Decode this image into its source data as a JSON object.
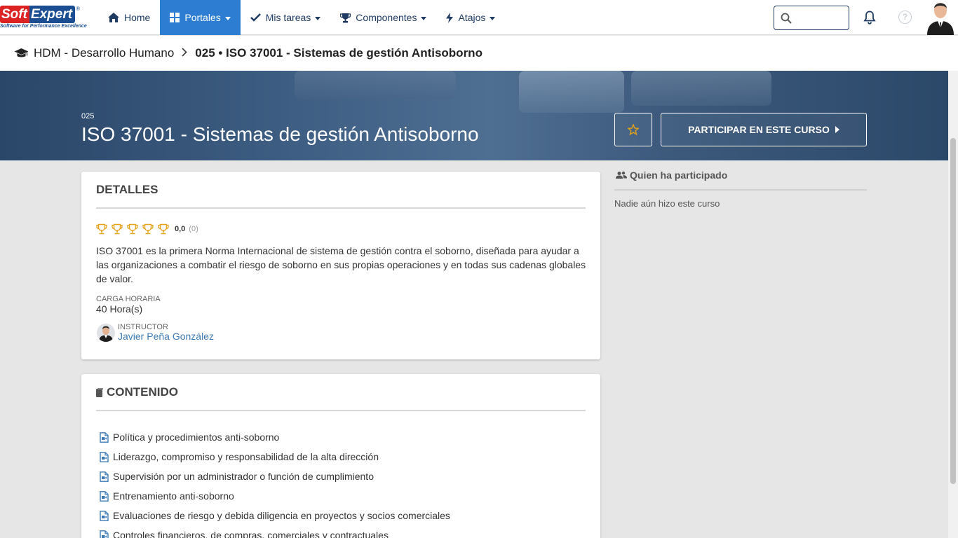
{
  "brand": {
    "part1": "Soft",
    "part2": "Expert",
    "tagline": "Software for Performance Excellence",
    "reg": "®"
  },
  "nav": {
    "items": [
      {
        "label": "Home",
        "icon": "home-icon"
      },
      {
        "label": "Portales",
        "icon": "grid-icon",
        "active": true
      },
      {
        "label": "Mis tareas",
        "icon": "check-icon"
      },
      {
        "label": "Componentes",
        "icon": "trophy-icon"
      },
      {
        "label": "Atajos",
        "icon": "bolt-icon"
      }
    ],
    "search_value": "",
    "help_glyph": "?"
  },
  "breadcrumb": {
    "parent": "HDM - Desarrollo Humano",
    "current": "025 • ISO 37001 - Sistemas de gestión Antisoborno"
  },
  "course": {
    "code": "025",
    "title": "ISO 37001 - Sistemas de gestión Antisoborno",
    "join_label": "PARTICIPAR EN ESTE CURSO"
  },
  "details": {
    "title": "DETALLES",
    "rating": "0,0",
    "rating_count": "(0)",
    "trophies": 5,
    "description": "ISO 37001 es la primera Norma Internacional de sistema de gestión contra el soborno, diseñada para ayudar a las organizaciones a combatir el riesgo de soborno en sus propias operaciones y en todas sus cadenas globales de valor.",
    "workload_label": "CARGA HORARIA",
    "workload_value": "40 Hora(s)",
    "instructor_label": "INSTRUCTOR",
    "instructor_name": "Javier Peña González"
  },
  "content": {
    "title": "CONTENIDO",
    "items": [
      "Política y procedimientos anti-soborno",
      "Liderazgo, compromiso y responsabilidad de la alta dirección",
      "Supervisión por un administrador o función de cumplimiento",
      "Entrenamiento anti-soborno",
      "Evaluaciones de riesgo y debida diligencia en proyectos y socios comerciales",
      "Controles financieros, de compras, comerciales y contractuales"
    ]
  },
  "participants": {
    "title": "Quien ha participado",
    "empty": "Nadie aún hizo este curso"
  },
  "colors": {
    "primary": "#2d7dd2",
    "navy": "#1f3b62",
    "gold": "#e3a21a",
    "link": "#3d7ab5"
  }
}
